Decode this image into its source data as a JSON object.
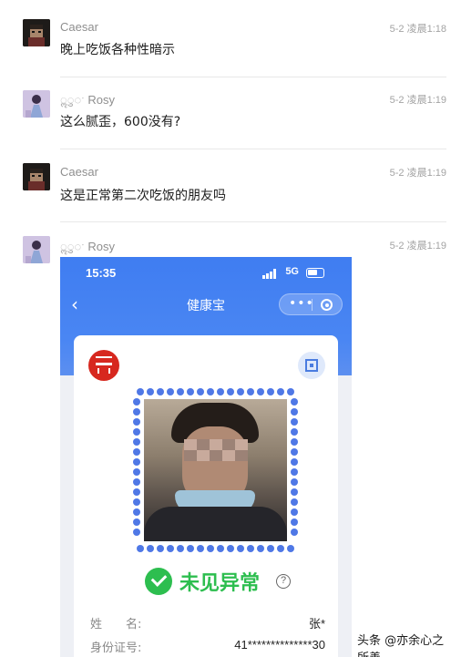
{
  "messages": [
    {
      "sender": "Caesar",
      "time": "5-2 凌晨1:18",
      "text": "晚上吃饭各种性暗示",
      "avatar": "caesar-avatar"
    },
    {
      "sender": "Rosy",
      "sender_prefix": "ॢ◌ु◌ˑ",
      "time": "5-2 凌晨1:19",
      "text": "这么腻歪，600没有?",
      "avatar": "rosy-avatar"
    },
    {
      "sender": "Caesar",
      "time": "5-2 凌晨1:19",
      "text": "这是正常第二次吃饭的朋友吗",
      "avatar": "caesar-avatar"
    },
    {
      "sender": "Rosy",
      "sender_prefix": "ॢ◌ु◌ˑ",
      "time": "5-2 凌晨1:19",
      "text": "",
      "avatar": "rosy-avatar"
    }
  ],
  "phone": {
    "clock": "15:35",
    "network": "5G",
    "nav_title": "健康宝",
    "more_label": "•••",
    "result": "未见异常",
    "help": "?",
    "fields": [
      {
        "label": "姓　　名:",
        "value": "张*"
      },
      {
        "label": "身份证号:",
        "value": "41**************30"
      }
    ]
  },
  "watermark": "头条 @亦余心之所善"
}
